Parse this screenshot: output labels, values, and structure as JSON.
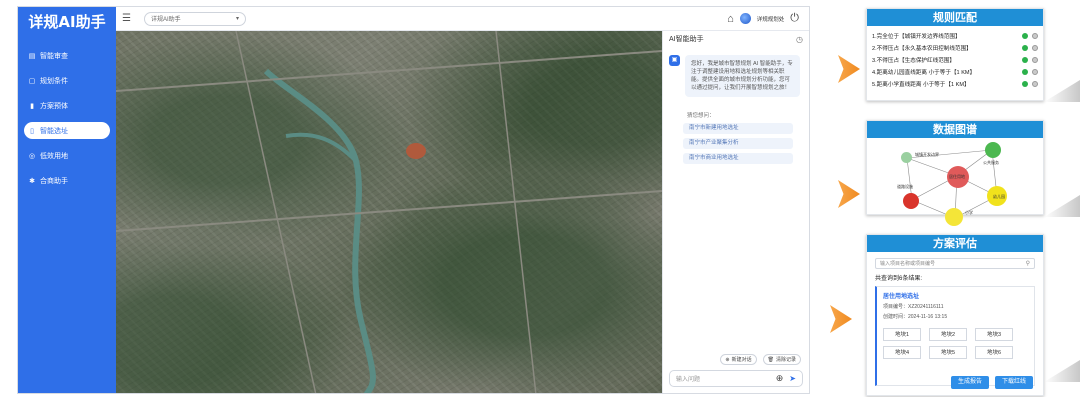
{
  "app": {
    "brand": "详规AI助手",
    "nav": [
      {
        "label": "智能审查",
        "icon": "doc-check-icon"
      },
      {
        "label": "规划条件",
        "icon": "clipboard-icon"
      },
      {
        "label": "方案预体",
        "icon": "bar-chart-icon"
      },
      {
        "label": "智能选址",
        "icon": "location-icon"
      },
      {
        "label": "低效用地",
        "icon": "target-icon"
      },
      {
        "label": "合商助手",
        "icon": "handshake-icon"
      }
    ],
    "active_nav": 3,
    "topbar": {
      "selector_value": "详规AI助手",
      "user_name": "详规规划处"
    },
    "chat": {
      "title": "AI智能助手",
      "welcome": "您好，我是城市智慧规划 AI 智能助手，专注于调整建设用地和选址规划等相关职能。提供全面的城市规划分析功能，您可以通过提问，让我们开展智慧规划之旅！",
      "suggest_title": "猜您想问：",
      "suggestions": [
        "南宁市新建用地选址",
        "南宁市产业聚集分析",
        "南宁市商业用地选址"
      ],
      "new_chat": "新建对话",
      "clear": "清除记录",
      "input_placeholder": "输入问题"
    }
  },
  "panels": {
    "rules": {
      "title": "规则匹配",
      "items": [
        "1.完全位于【城镇开发边界线范围】",
        "2.不得压占【永久基本农田控制线范围】",
        "3.不得压占【生态保护红线范围】",
        "4.距离幼儿园直线距离 小于等于【1 KM】",
        "5.距离小学直线距离 小于等于【1 KM】"
      ]
    },
    "graph": {
      "title": "数据图谱",
      "node_labels": [
        "居住用地",
        "公共服务",
        "道路设施",
        "幼儿园",
        "小学",
        "城镇开发边界"
      ]
    },
    "evaluation": {
      "title": "方案评估",
      "search_placeholder": "输入项目名称或项目编号",
      "result_count": "共查询到6条结果:",
      "project_name": "居住用地选址",
      "project_code": "项目编号：XZ20241116111",
      "created": "创建时间：2024-11-16 13:15",
      "plots": [
        "地块1",
        "地块2",
        "地块3",
        "地块4",
        "地块5",
        "地块6"
      ],
      "btn_report": "生成报告",
      "btn_download": "下载红线"
    }
  },
  "colors": {
    "sidebar": "#2f6fe8",
    "panel_header": "#1f8fd6",
    "arrow": "#f39a33",
    "rule_ok": "#2bb14b"
  }
}
